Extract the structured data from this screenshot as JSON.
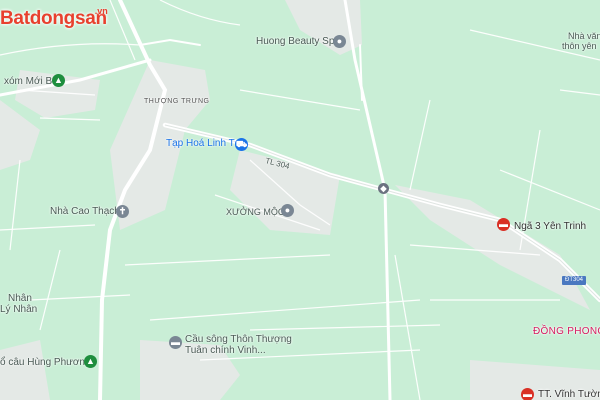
{
  "brand": {
    "name": "Batdongsan",
    "suffix": ".vn"
  },
  "places": {
    "beauty_spa": "Huong Beauty Spa",
    "xom_moi": "xóm Mới B",
    "thuong_trung": "THƯỢNG TRƯNG",
    "tap_hoa": "Tạp Hoá Linh Tơ",
    "road_tl304": "TL 304",
    "nha_cao_thach": "Nhà Cao Thạch",
    "xuong_moc": "XƯỞNG MỘC",
    "nga3": "Ngã 3 Yên Trinh",
    "dt304": "ĐT304",
    "nha_van_1": "Nhà văn",
    "nha_van_2": "thôn yên",
    "nhan_1": "Nhân",
    "nhan_2": "Lý Nhân",
    "dong_phong": "ĐỒNG PHONG H",
    "cau_song_1": "Cầu sông Thôn Thượng",
    "cau_song_2": "Tuân chính Vinh...",
    "hung_phuong": "ổ câu Hùng Phương",
    "tt_vinh": "TT. Vĩnh Tường"
  },
  "colors": {
    "land": "#c9eed6",
    "road": "#ffffff",
    "built": "#e6eae8",
    "brand": "#e8402e"
  },
  "icons": [
    "shopping-cart-icon",
    "place-icon",
    "transit-icon",
    "route-shield-icon"
  ]
}
